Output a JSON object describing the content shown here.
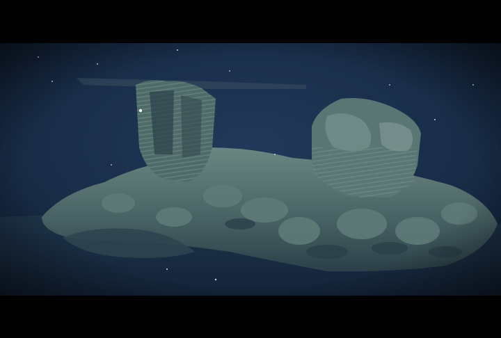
{
  "image": {
    "subject": "deep-sea-lava-pillars",
    "colors": {
      "water_deep": "#14243a",
      "water_mid": "#1c3350",
      "rock_light": "#5e7a78",
      "rock_mid": "#3f5a5e",
      "rock_dark": "#253a44",
      "letterbox": "#000000"
    }
  }
}
